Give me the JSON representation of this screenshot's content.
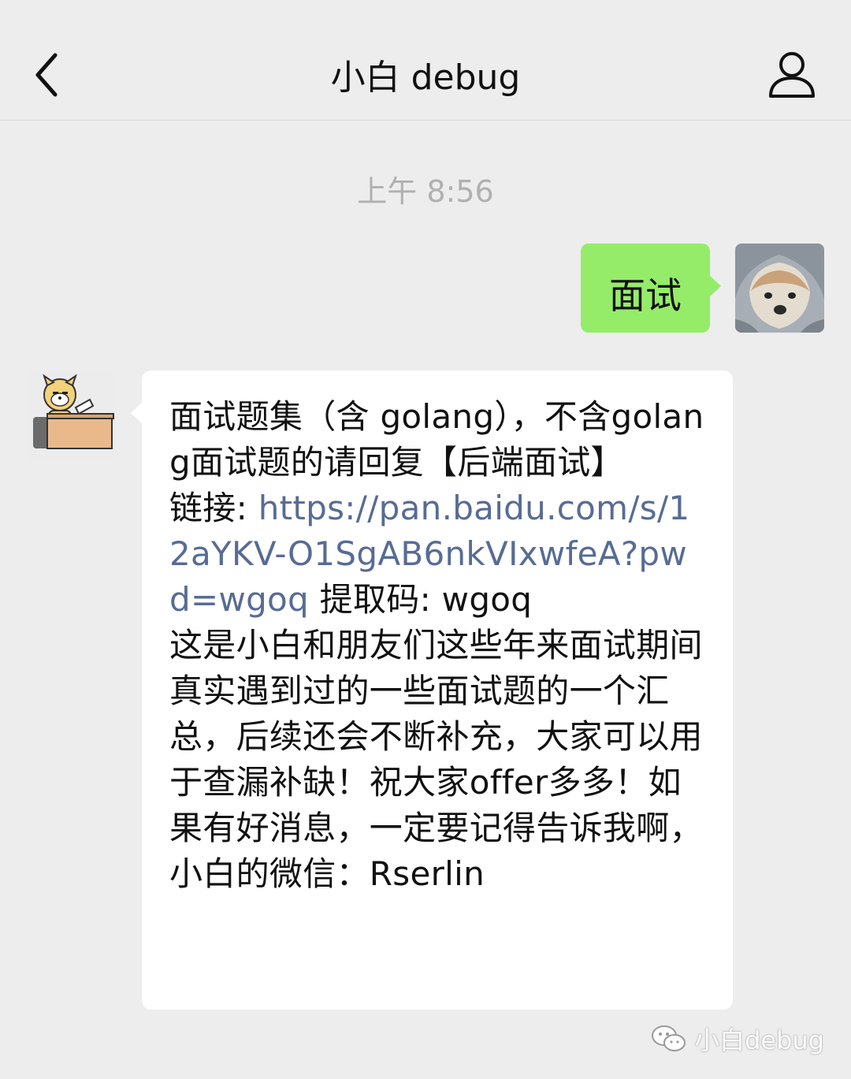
{
  "header": {
    "title": "小白 debug"
  },
  "icons": {
    "back": "chevron-left-icon",
    "profile": "person-icon",
    "watermark": "wechat-icon"
  },
  "chat": {
    "timestamp": "上午 8:56",
    "outgoing": {
      "text": "面试"
    },
    "incoming": {
      "intro": "面试题集（含 golang），不含golang面试题的请回复【后端面试】",
      "link_label": "链接: ",
      "link_url": "https://pan.baidu.com/s/12aYKV-O1SgAB6nkVIxwfeA?pwd=wgoq",
      "code_label": " 提取码: wgoq",
      "body": "这是小白和朋友们这些年来面试期间真实遇到过的一些面试题的一个汇总，后续还会不断补充，大家可以用于查漏补缺！祝大家offer多多！如果有好消息，一定要记得告诉我啊，小白的微信：Rserlin"
    }
  },
  "watermark": {
    "text": "小白debug"
  },
  "colors": {
    "background": "#ededed",
    "outgoing_bubble": "#95ec69",
    "incoming_bubble": "#ffffff",
    "link": "#576b95"
  }
}
